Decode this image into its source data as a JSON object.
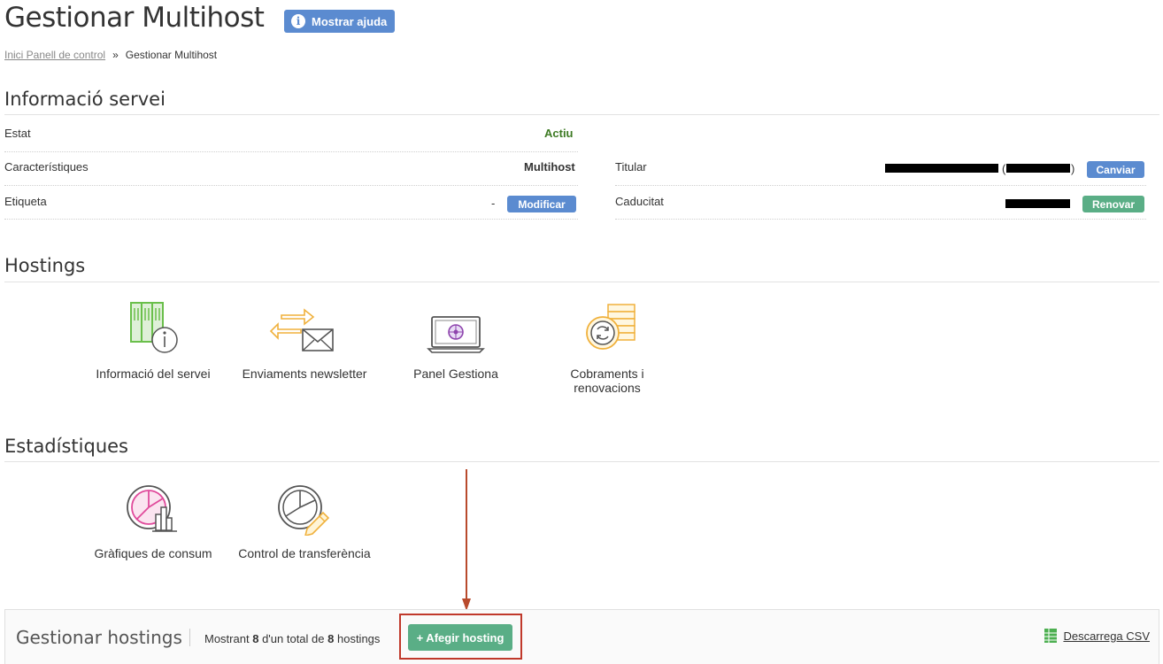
{
  "header": {
    "title": "Gestionar Multihost",
    "help_label": "Mostrar ajuda",
    "help_icon": "info-icon"
  },
  "breadcrumb": {
    "home": "Inici Panell de control",
    "separator": "»",
    "current": "Gestionar Multihost"
  },
  "service_info": {
    "title": "Informació servei",
    "estat_label": "Estat",
    "estat_value": "Actiu",
    "caracteristiques_label": "Característiques",
    "caracteristiques_value": "Multihost",
    "etiqueta_label": "Etiqueta",
    "etiqueta_value": "-",
    "modificar_label": "Modificar",
    "titular_label": "Titular",
    "titular_paren_open": "(",
    "titular_paren_close": ")",
    "canviar_label": "Canviar",
    "caducitat_label": "Caducitat",
    "renovar_label": "Renovar"
  },
  "hostings": {
    "title": "Hostings",
    "tiles": [
      {
        "label": "Informació del servei",
        "icon": "server-info-icon"
      },
      {
        "label": "Enviaments newsletter",
        "icon": "newsletter-icon"
      },
      {
        "label": "Panel Gestiona",
        "icon": "laptop-panel-icon"
      },
      {
        "label": "Cobraments i renovacions",
        "icon": "coins-renewal-icon"
      }
    ]
  },
  "stats": {
    "title": "Estadístiques",
    "tiles": [
      {
        "label": "Gràfiques de consum",
        "icon": "consumption-chart-icon"
      },
      {
        "label": "Control de transferència",
        "icon": "transfer-pie-icon"
      }
    ]
  },
  "manage": {
    "title": "Gestionar hostings",
    "count_prefix": "Mostrant",
    "count_shown": "8",
    "count_middle": "d'un total de",
    "count_total": "8",
    "count_suffix": "hostings",
    "add_label": "+ Afegir hosting",
    "csv_label": "Descarrega CSV",
    "csv_icon": "spreadsheet-icon"
  },
  "colors": {
    "blue_button": "#5b8bd0",
    "green_button": "#5aae86",
    "status_green": "#3d7a23",
    "highlight_red": "#c0392b"
  }
}
